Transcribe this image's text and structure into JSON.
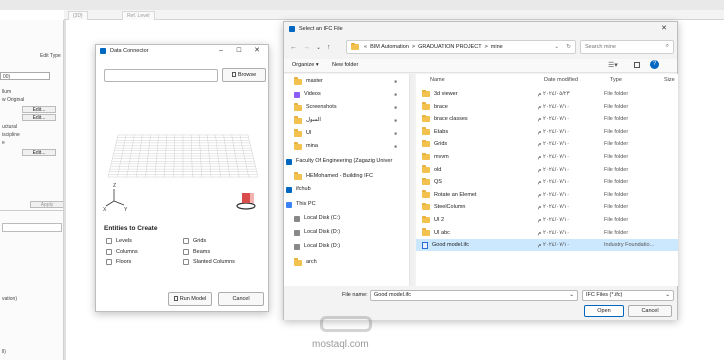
{
  "background_app": {
    "tabs": [
      "{3D}",
      "Ref. Level"
    ],
    "edit_type_label": "Edit Type",
    "prop_rows": [
      "00)",
      "llum",
      "w Original",
      "Edit...",
      "Edit...",
      "uctural",
      "iscipline",
      "e",
      "Edit...",
      "Apply",
      "vation)",
      "ll)"
    ]
  },
  "data_connector": {
    "title": "Data Connector",
    "browse_label": "Browse",
    "path_value": "",
    "section_title": "Entities to Create",
    "checkboxes": [
      "Levels",
      "Grids",
      "Columns",
      "Beams",
      "Floors",
      "Slanted Columns"
    ],
    "run_label": "Run Model",
    "cancel_label": "Cancel",
    "axis_z": "Z",
    "axis_x": "X",
    "axis_y": "Y"
  },
  "file_dialog": {
    "title": "Select an IFC File",
    "breadcrumb": [
      "«",
      "BIM Automation",
      ">",
      "GRADUATION PROJECT",
      ">",
      "mine"
    ],
    "search_placeholder": "Search mine",
    "organize_label": "Organize",
    "new_folder_label": "New folder",
    "columns": [
      "Name",
      "Date modified",
      "Type",
      "Size"
    ],
    "nav_items": [
      {
        "label": "master",
        "icon": "folder"
      },
      {
        "label": "Videos",
        "icon": "videos"
      },
      {
        "label": "Screenshots",
        "icon": "folder"
      },
      {
        "label": "السول",
        "icon": "folder"
      },
      {
        "label": "UI",
        "icon": "folder"
      },
      {
        "label": "mina",
        "icon": "folder"
      },
      {
        "label": "Faculty Of Engineering (Zagazig Univer",
        "icon": "cloud"
      },
      {
        "label": "HEMohamed - Building IFC",
        "icon": "folder"
      },
      {
        "label": "ifchub",
        "icon": "cloud"
      },
      {
        "label": "This PC",
        "icon": "pc"
      },
      {
        "label": "Local Disk (C:)",
        "icon": "disk"
      },
      {
        "label": "Local Disk (D:)",
        "icon": "disk"
      },
      {
        "label": "Local Disk (D:)",
        "icon": "disk"
      },
      {
        "label": "arch",
        "icon": "folder"
      }
    ],
    "files": [
      {
        "name": "3d viewer",
        "date": "٢٠٢٤/٠٥/٢٣ م",
        "type": "File folder"
      },
      {
        "name": "brace",
        "date": "٢٠٢٤/٠٧/١٠ م",
        "type": "File folder"
      },
      {
        "name": "brace classes",
        "date": "٢٠٢٤/٠٧/١٠ م",
        "type": "File folder"
      },
      {
        "name": "Etabs",
        "date": "٢٠٢٤/٠٧/١٠ م",
        "type": "File folder"
      },
      {
        "name": "Grids",
        "date": "٢٠٢٤/٠٧/١٠ م",
        "type": "File folder"
      },
      {
        "name": "mvvm",
        "date": "٢٠٢٤/٠٧/١٠ م",
        "type": "File folder"
      },
      {
        "name": "old",
        "date": "٢٠٢٤/٠٧/١٠ م",
        "type": "File folder"
      },
      {
        "name": "QS",
        "date": "٢٠٢٤/٠٧/١٠ م",
        "type": "File folder"
      },
      {
        "name": "Rotate an Elemet",
        "date": "٢٠٢٤/٠٧/١٠ م",
        "type": "File folder"
      },
      {
        "name": "SteelColumn",
        "date": "٢٠٢٤/٠٧/١٠ م",
        "type": "File folder"
      },
      {
        "name": "UI 2",
        "date": "٢٠٢٤/٠٧/١٠ م",
        "type": "File folder"
      },
      {
        "name": "UI abc",
        "date": "٢٠٢٤/٠٧/١٠ م",
        "type": "File folder"
      },
      {
        "name": "Good model.ifc",
        "date": "٢٠٢٤/٠٧/١٠ م",
        "type": "Industry Foundatio..."
      }
    ],
    "file_name_label": "File name:",
    "file_name_value": "Good model.ifc",
    "filter_value": "IFC Files (*.ifc)",
    "open_label": "Open",
    "cancel_label": "Cancel"
  },
  "watermark": {
    "text": "mostaql.com"
  },
  "colors": {
    "accent": "#0067c0",
    "selection": "#cce8ff",
    "folder": "#f2c14e"
  }
}
